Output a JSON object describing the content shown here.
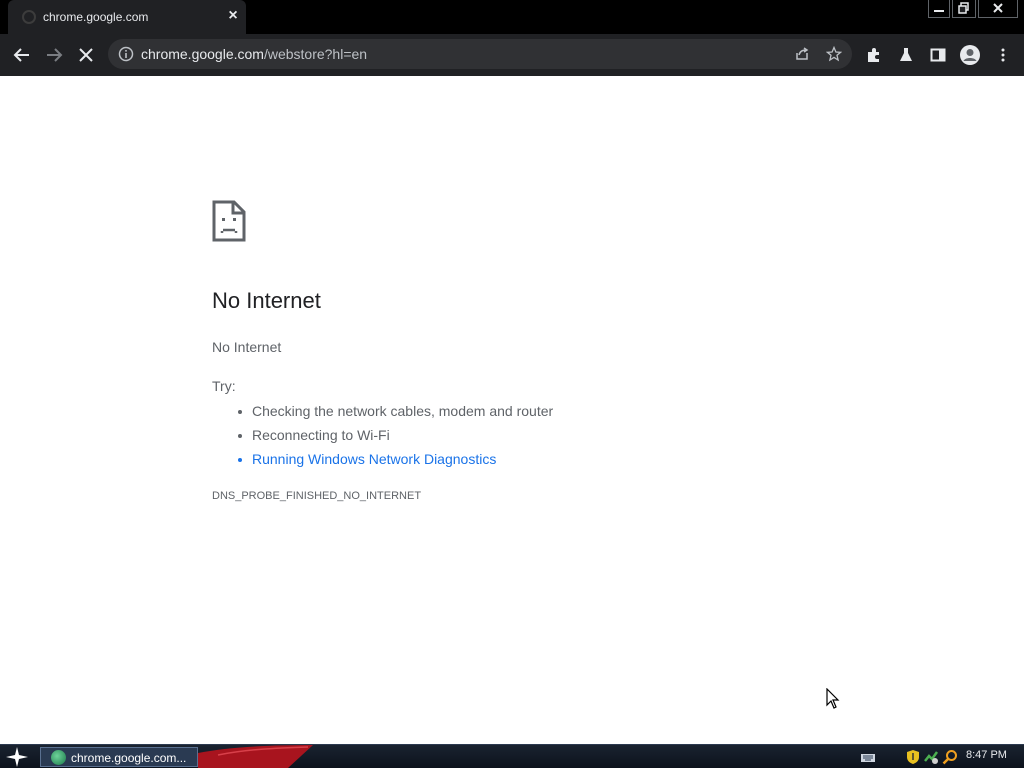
{
  "tab": {
    "title": "chrome.google.com"
  },
  "toolbar": {
    "url_host": "chrome.google.com",
    "url_path": "/webstore?hl=en"
  },
  "error_page": {
    "heading": "No Internet",
    "subtext": "No Internet",
    "try_label": "Try:",
    "suggestions": [
      "Checking the network cables, modem and router",
      "Reconnecting to Wi-Fi",
      "Running Windows Network Diagnostics"
    ],
    "error_code": "DNS_PROBE_FINISHED_NO_INTERNET"
  },
  "taskbar": {
    "task_label": "chrome.google.com...",
    "clock": "8:47 PM"
  },
  "colors": {
    "link": "#1a73e8",
    "toolbar_bg": "#202124",
    "text_secondary": "#5f6368"
  }
}
